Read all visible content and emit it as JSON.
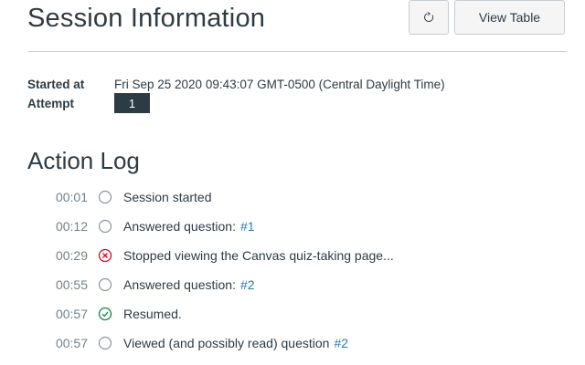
{
  "header": {
    "title": "Session Information",
    "refresh_icon": "refresh-icon",
    "view_table_label": "View Table"
  },
  "info": {
    "started_label": "Started at",
    "started_value": "Fri Sep 25 2020 09:43:07 GMT-0500 (Central Daylight Time)",
    "attempt_label": "Attempt",
    "attempt_value": "1"
  },
  "log": {
    "title": "Action Log",
    "items": [
      {
        "time": "00:01",
        "status": "neutral",
        "text": "Session started",
        "link": ""
      },
      {
        "time": "00:12",
        "status": "neutral",
        "text": "Answered question:",
        "link": "#1"
      },
      {
        "time": "00:29",
        "status": "error",
        "text": "Stopped viewing the Canvas quiz-taking page...",
        "link": ""
      },
      {
        "time": "00:55",
        "status": "neutral",
        "text": "Answered question:",
        "link": "#2"
      },
      {
        "time": "00:57",
        "status": "success",
        "text": "Resumed.",
        "link": ""
      },
      {
        "time": "00:57",
        "status": "neutral",
        "text": "Viewed (and possibly read) question",
        "link": "#2"
      }
    ]
  },
  "colors": {
    "text": "#2d3b45",
    "muted": "#73818c",
    "link": "#2b7abc",
    "error": "#e0061f",
    "success": "#0b874b",
    "neutral": "#8b969e",
    "badge": "#2d3b45"
  }
}
